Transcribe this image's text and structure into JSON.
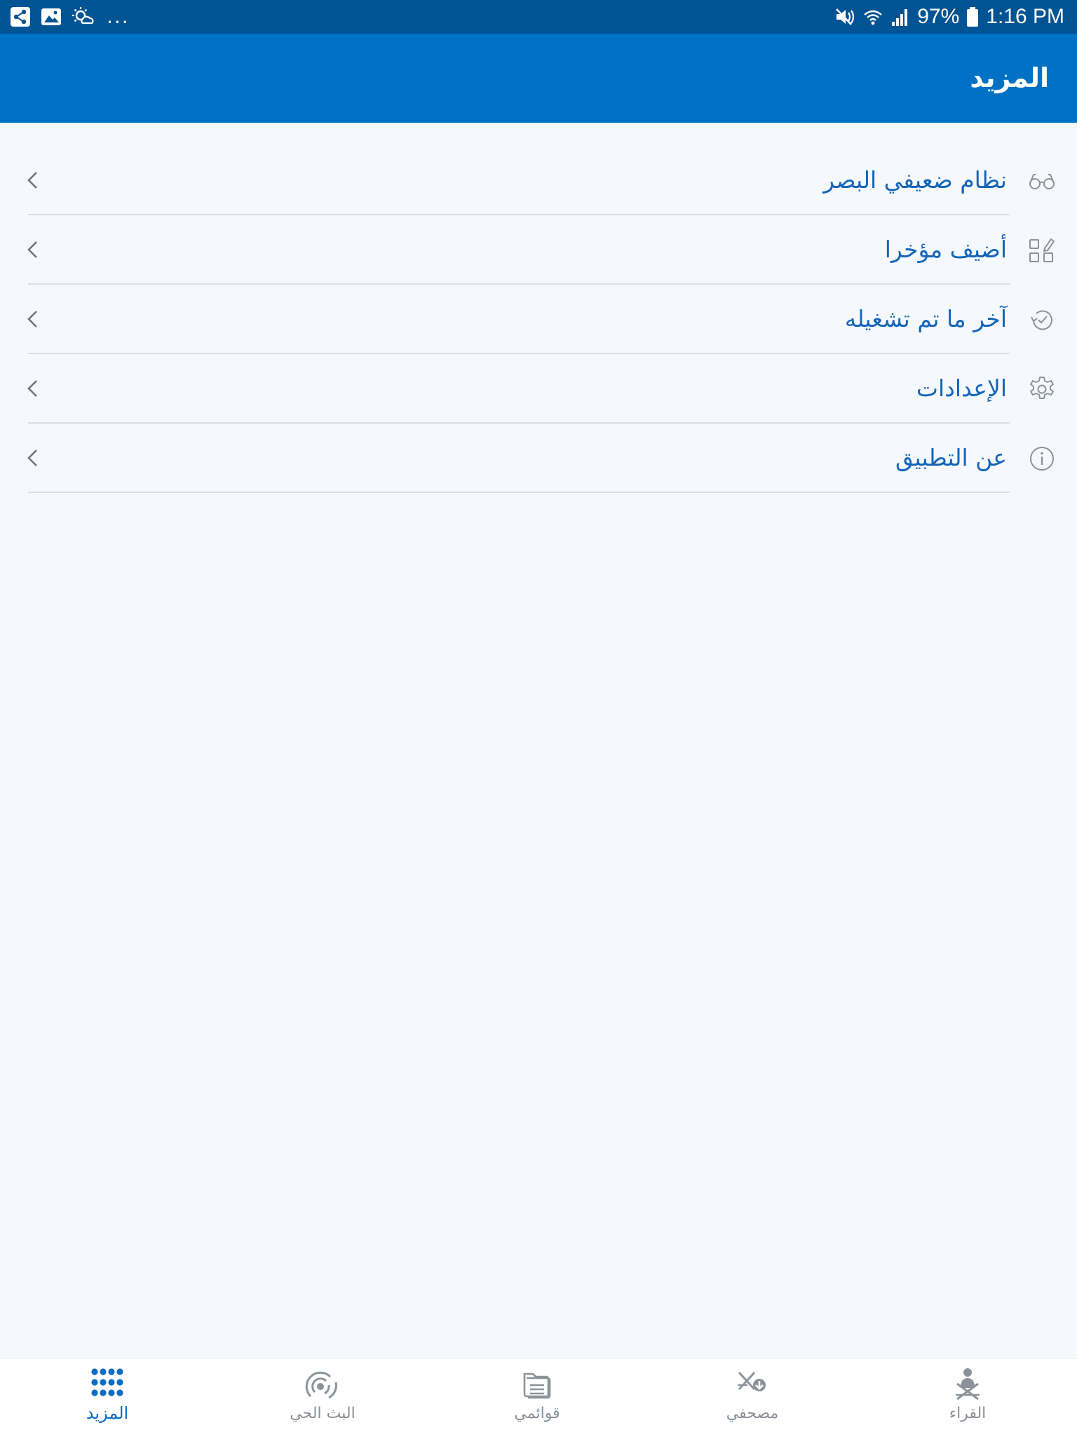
{
  "status_bar": {
    "left_icons": [
      "share-icon",
      "image-icon",
      "weather-icon"
    ],
    "overflow": "...",
    "battery": "97%",
    "time": "1:16 PM",
    "right_icons": [
      "mute-icon",
      "wifi-icon",
      "signal-icon",
      "battery-icon"
    ]
  },
  "header": {
    "title": "المزيد"
  },
  "menu": {
    "items": [
      {
        "label": "نظام ضعيفي البصر",
        "icon": "glasses-icon"
      },
      {
        "label": "أضيف مؤخرا",
        "icon": "grid-edit-icon"
      },
      {
        "label": "آخر ما تم تشغيله",
        "icon": "history-icon"
      },
      {
        "label": "الإعدادات",
        "icon": "gear-icon"
      },
      {
        "label": "عن التطبيق",
        "icon": "info-icon"
      }
    ]
  },
  "bottom_nav": {
    "items": [
      {
        "label": "القراء",
        "icon": "reciter-icon",
        "active": false
      },
      {
        "label": "مصحفي",
        "icon": "my-mushaf-icon",
        "active": false
      },
      {
        "label": "قوائمي",
        "icon": "playlists-icon",
        "active": false
      },
      {
        "label": "البث الحي",
        "icon": "live-broadcast-icon",
        "active": false
      },
      {
        "label": "المزيد",
        "icon": "more-dots-icon",
        "active": true
      }
    ]
  },
  "colors": {
    "status_bar": "#005493",
    "app_bar": "#0071c5",
    "background": "#f5f9fe",
    "menu_text": "#1565b8",
    "active_nav": "#0e6cc0",
    "inactive_nav": "#8a8f96"
  }
}
